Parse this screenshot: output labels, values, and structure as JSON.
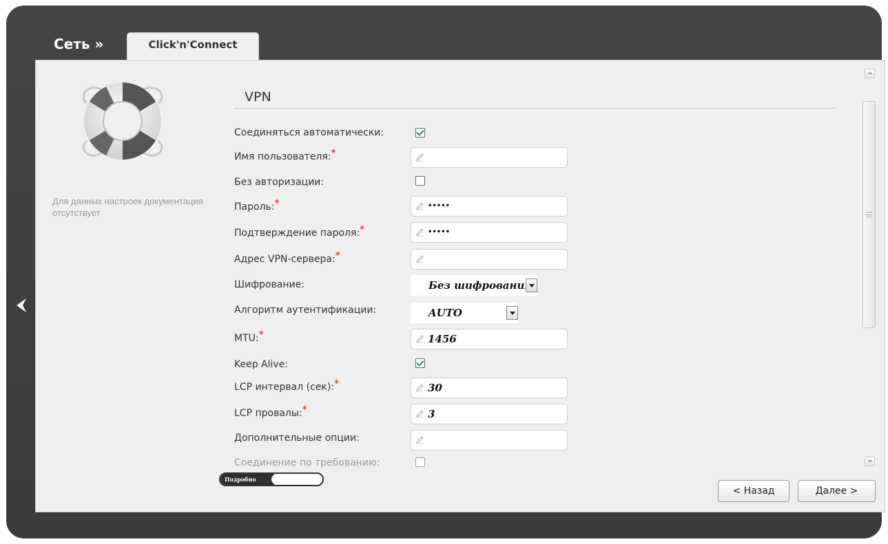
{
  "header": {
    "breadcrumb": "Сеть »",
    "tab_label": "Click'n'Connect"
  },
  "sidebar": {
    "doc_note": "Для данных настроек документация отсутствует"
  },
  "section": {
    "title": "VPN"
  },
  "form": {
    "auto_connect": {
      "label": "Соединяться автоматически:",
      "checked": true
    },
    "username": {
      "label": "Имя пользователя:",
      "value": ""
    },
    "no_auth": {
      "label": "Без авторизации:",
      "checked": false
    },
    "password": {
      "label": "Пароль:",
      "value": "•••••"
    },
    "password_confirm": {
      "label": "Подтверждение пароля:",
      "value": "•••••"
    },
    "vpn_server": {
      "label": "Адрес VPN-сервера:",
      "value": ""
    },
    "encryption": {
      "label": "Шифрование:",
      "value": "Без шифрования"
    },
    "auth_algorithm": {
      "label": "Алгоритм аутентификации:",
      "value": "AUTO"
    },
    "mtu": {
      "label": "MTU:",
      "value": "1456"
    },
    "keep_alive": {
      "label": "Keep Alive:",
      "checked": true
    },
    "lcp_interval": {
      "label": "LCP интервал (сек):",
      "value": "30"
    },
    "lcp_failures": {
      "label": "LCP провалы:",
      "value": "3"
    },
    "extra_options": {
      "label": "Дополнительные опции:",
      "value": ""
    },
    "on_demand": {
      "label": "Соединение по требованию:",
      "checked": false
    },
    "required_mark": "*"
  },
  "toggle": {
    "label": "Подробно"
  },
  "buttons": {
    "back": "< Назад",
    "next": "Далее >"
  },
  "icons": {
    "back_arrow": "chevron-left-icon",
    "lifebuoy": "lifebuoy-icon",
    "pencil": "pencil-icon"
  }
}
